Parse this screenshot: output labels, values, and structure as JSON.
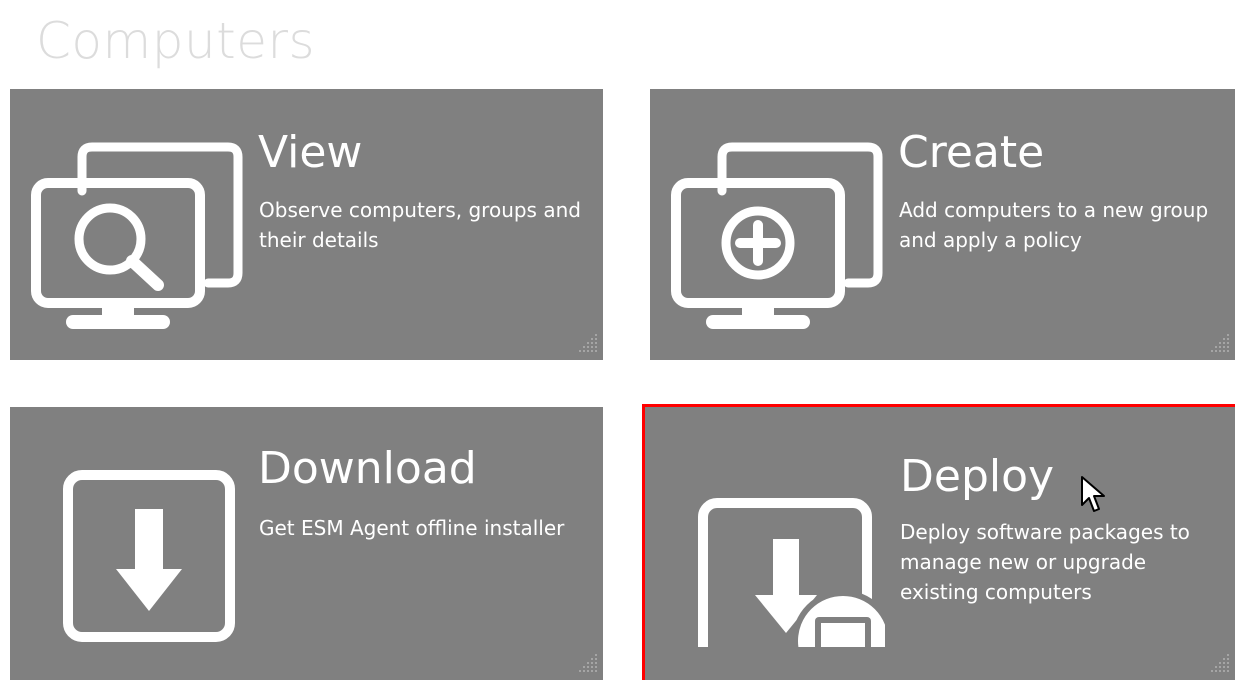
{
  "page": {
    "title": "Computers"
  },
  "tiles": [
    {
      "id": "view",
      "title": "View",
      "description": "Observe computers, groups and their details",
      "icon": "monitor-search-icon"
    },
    {
      "id": "create",
      "title": "Create",
      "description": "Add computers to a new group and apply a policy",
      "icon": "monitor-add-icon"
    },
    {
      "id": "download",
      "title": "Download",
      "description": "Get ESM Agent offline installer",
      "icon": "download-icon"
    },
    {
      "id": "deploy",
      "title": "Deploy",
      "description": "Deploy software packages to manage new or upgrade existing computers",
      "icon": "deploy-computer-icon",
      "selected": true
    }
  ],
  "colors": {
    "tile_bg": "#808080",
    "tile_text": "#ffffff",
    "title_text": "#dcdcdc",
    "selection": "#ff0000"
  }
}
